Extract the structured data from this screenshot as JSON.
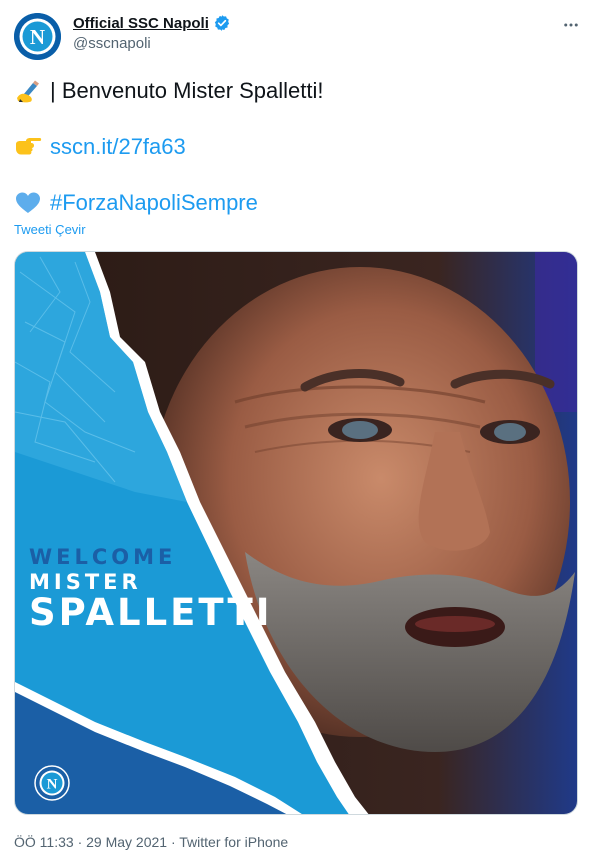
{
  "author": {
    "display_name": "Official SSC Napoli",
    "handle": "@sscnapoli",
    "verified": true,
    "avatar_icon": "ssc-napoli-logo-icon",
    "avatar_letter": "N"
  },
  "more_icon": "more-options-icon",
  "tweet": {
    "line1_text": "| Benvenuto Mister Spalletti!",
    "line1_icon": "writing-hand-icon",
    "line2_link": "sscn.it/27fa63",
    "line2_icon": "pointing-hand-icon",
    "line3_hashtag": "#ForzaNapoliSempre",
    "line3_icon": "blue-heart-icon"
  },
  "translate_label": "Tweeti Çevir",
  "media": {
    "headline_line1": "WELCOME",
    "headline_line2": "MISTER",
    "headline_line3": "SPALLETTI",
    "badge_letter": "N"
  },
  "meta": {
    "time": "ÖÖ 11:33",
    "separator": "·",
    "date": "29 May 2021",
    "source": "Twitter for iPhone"
  },
  "colors": {
    "link": "#1d9bf0",
    "napoli_blue": "#1b9ad6",
    "napoli_dark_blue": "#1b5fa6",
    "text_secondary": "#536471"
  }
}
